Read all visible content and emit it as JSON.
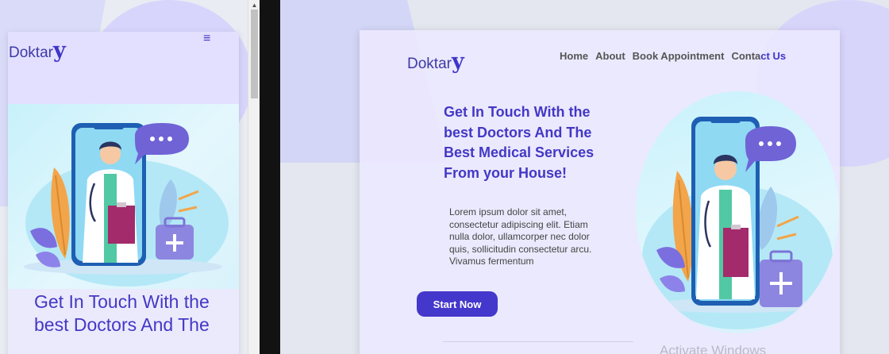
{
  "brand": {
    "name_text": "Doktar",
    "name_letter": "y"
  },
  "nav": {
    "items": [
      "Home",
      "About",
      "Book Appointment",
      "Conta",
      "ct Us"
    ]
  },
  "hero": {
    "heading": "Get In Touch With the best Doctors And The Best Medical Services From your House!",
    "heading_mobile": "Get In Touch With the best Doctors And The",
    "body": "Lorem ipsum dolor sit amet, consectetur adipiscing elit. Etiam nulla dolor, ullamcorper nec dolor quis, sollicitudin consectetur arcu. Vivamus fermentum",
    "cta_label": "Start Now"
  },
  "icons": {
    "menu": "hamburger-menu-icon",
    "chat": "chat-bubble-icon",
    "medkit": "medical-kit-icon",
    "scroll_up": "scroll-up-arrow-icon"
  },
  "glyphs": {
    "menu": "≡",
    "scroll_up": "▲"
  },
  "watermark": "Activate Windows",
  "colors": {
    "brand": "#4338c5",
    "button": "#4437cb",
    "card": "#ece9ff"
  }
}
